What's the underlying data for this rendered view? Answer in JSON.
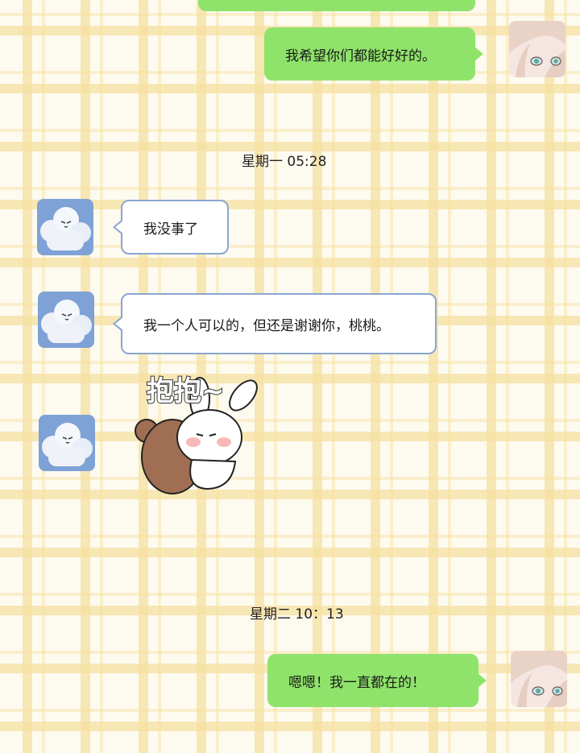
{
  "messages": [
    {
      "side": "right",
      "text": "我希望你们都能好好的。"
    },
    {
      "side": "left",
      "text": "我没事了"
    },
    {
      "side": "left",
      "text": "我一个人可以的，但还是谢谢你，桃桃。"
    },
    {
      "side": "left",
      "sticker_text": "抱抱~"
    },
    {
      "side": "right",
      "text": "嗯嗯！我一直都在的！"
    }
  ],
  "timestamps": [
    "星期一 05:28",
    "星期二 10：13"
  ],
  "avatars": {
    "friend": {
      "icon": "cloud-creature-avatar",
      "bg": "#7ea2d6"
    },
    "me": {
      "icon": "anime-girl-avatar",
      "bg": "#f6e6e2"
    }
  },
  "colors": {
    "outgoing_bubble": "#8fe36a",
    "incoming_border": "#8aa6d0",
    "plaid": "#f6e0a0"
  }
}
